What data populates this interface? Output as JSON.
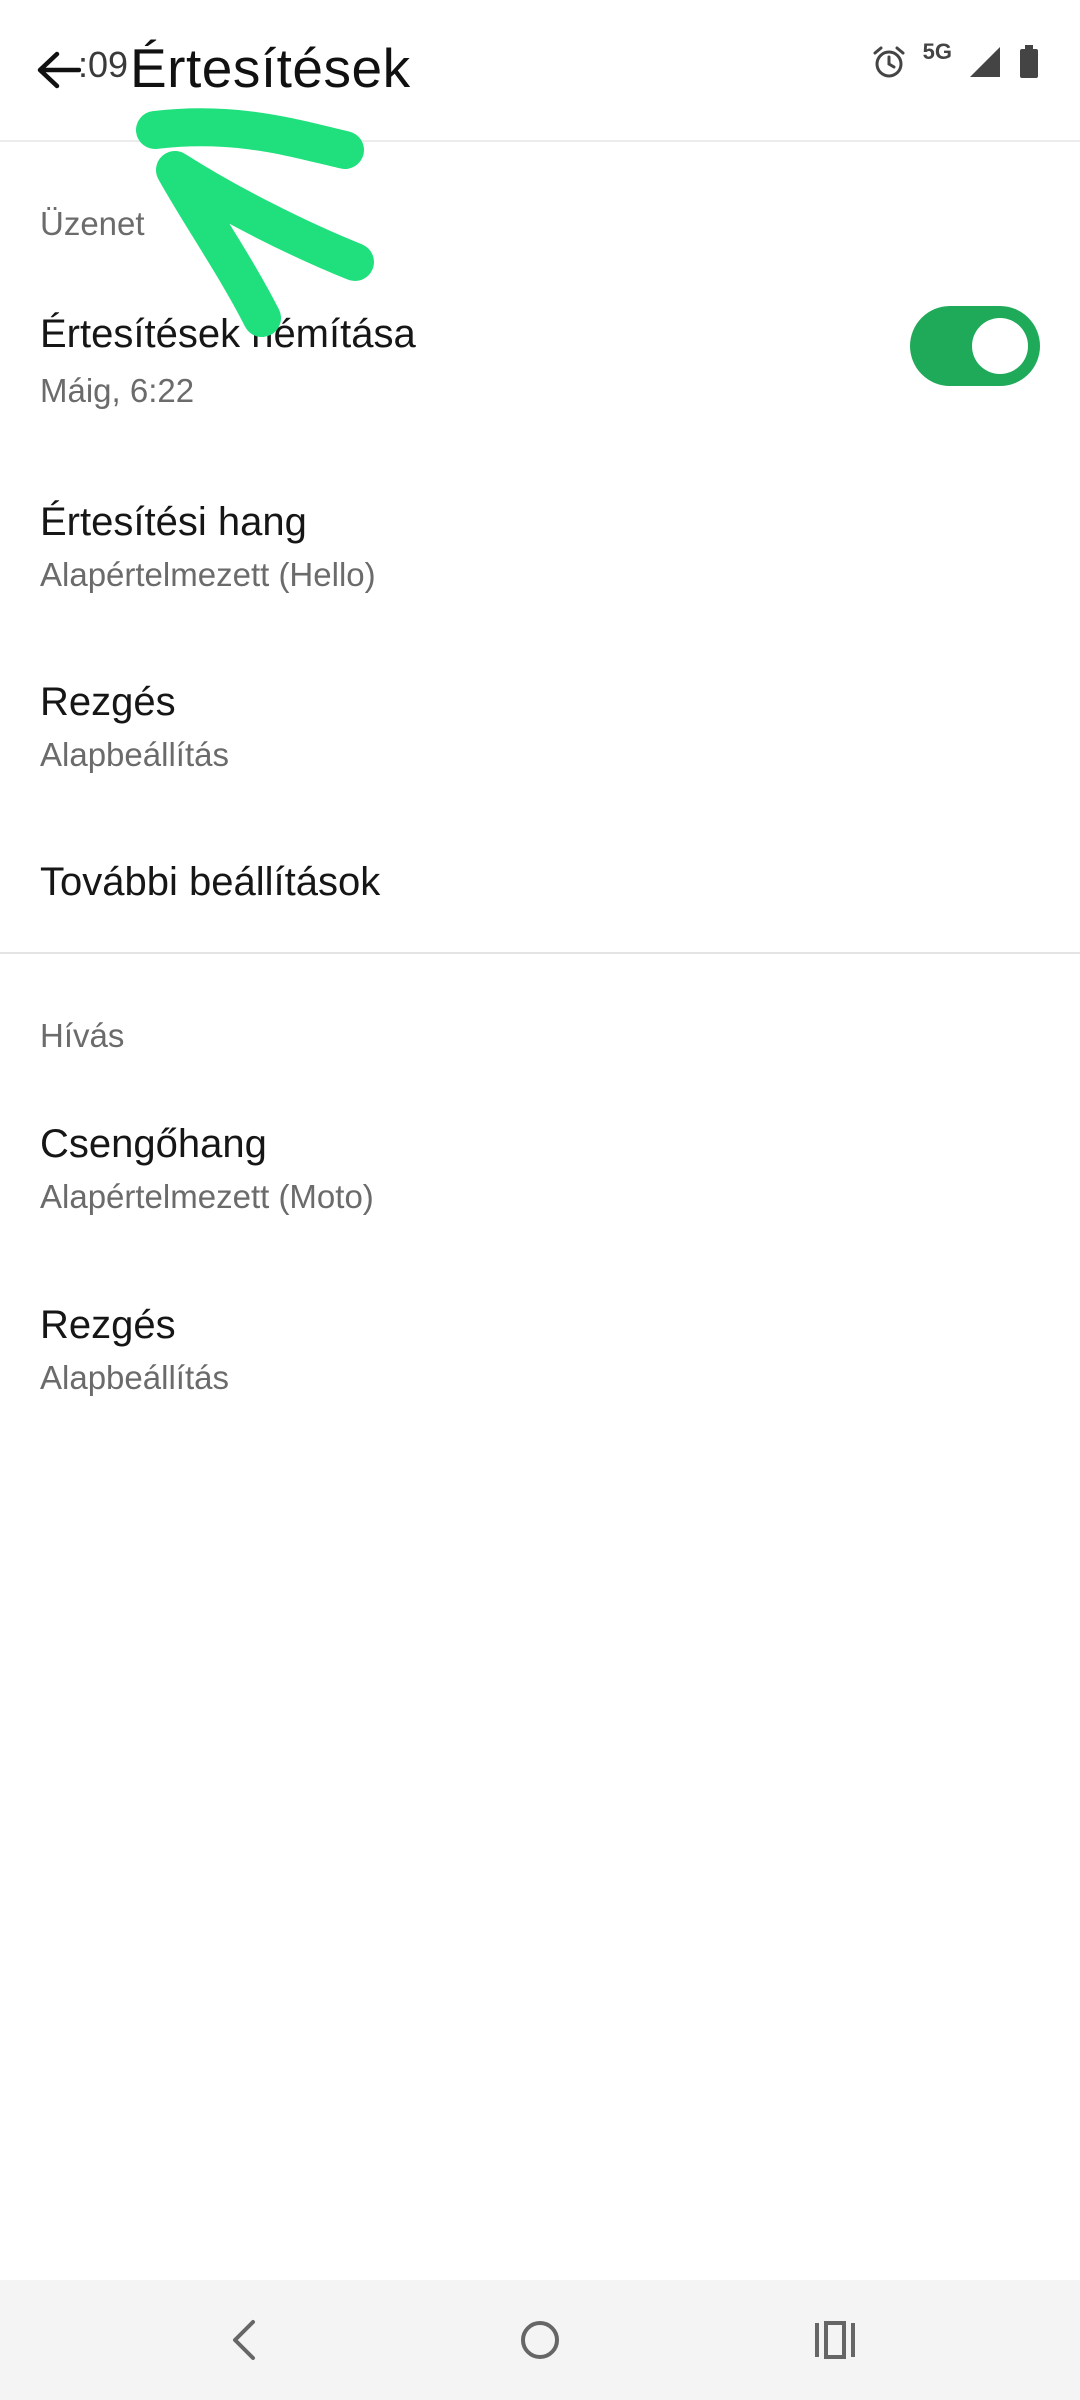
{
  "status_bar": {
    "time": ":09",
    "network": "5G",
    "icons": [
      "alarm-icon",
      "signal-icon",
      "battery-icon"
    ]
  },
  "header": {
    "title": "Értesítések",
    "back_icon": "arrow-left-icon"
  },
  "sections": [
    {
      "header": "Üzenet",
      "items": [
        {
          "title": "Értesítések némítása",
          "subtitle": "Máig, 6:22",
          "toggle_on": true
        },
        {
          "title": "Értesítési hang",
          "subtitle": "Alapértelmezett (Hello)"
        },
        {
          "title": "Rezgés",
          "subtitle": "Alapbeállítás"
        },
        {
          "title": "További beállítások"
        }
      ]
    },
    {
      "header": "Hívás",
      "items": [
        {
          "title": "Csengőhang",
          "subtitle": "Alapértelmezett (Moto)"
        },
        {
          "title": "Rezgés",
          "subtitle": "Alapbeállítás"
        }
      ]
    }
  ],
  "nav_bar": {
    "icons": [
      "nav-back-icon",
      "nav-home-icon",
      "nav-recents-icon"
    ]
  },
  "colors": {
    "accent": "#1faa59",
    "annotation": "#1fe07c",
    "subtitle": "#6b6b6b",
    "divider": "#e4e4e4"
  }
}
